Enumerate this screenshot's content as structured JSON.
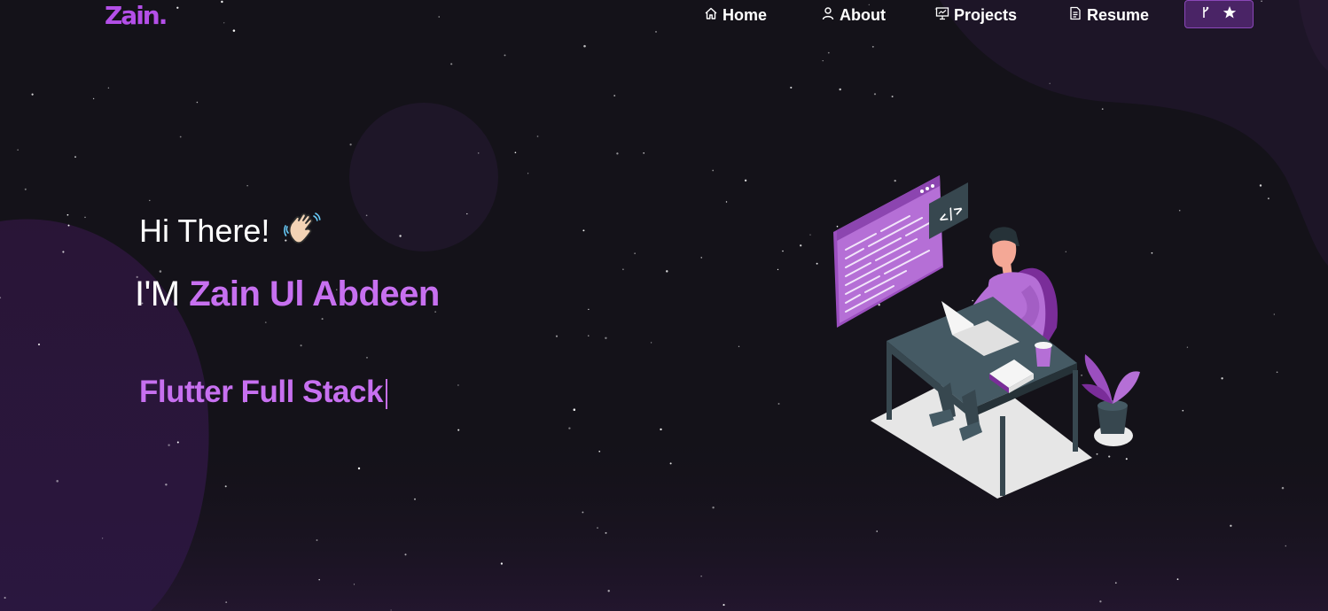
{
  "nav": {
    "brand": "Zain",
    "brand_dot": ".",
    "items": [
      {
        "label": "Home",
        "icon": "home-icon"
      },
      {
        "label": "About",
        "icon": "user-icon"
      },
      {
        "label": "Projects",
        "icon": "projects-icon"
      },
      {
        "label": "Resume",
        "icon": "document-icon"
      }
    ],
    "github_button": {
      "icons": [
        "git-fork-icon",
        "star-icon"
      ]
    }
  },
  "hero": {
    "greeting": "Hi There!",
    "greeting_emoji": "waving-hand-icon",
    "intro_prefix": "I'M",
    "name": "Zain Ul Abdeen",
    "typed_text": "Flutter Full Stack"
  },
  "illustration": {
    "code_tag": "</>"
  },
  "colors": {
    "accent": "#c770f0",
    "background": "#141219",
    "button_bg": "#4a2466"
  }
}
